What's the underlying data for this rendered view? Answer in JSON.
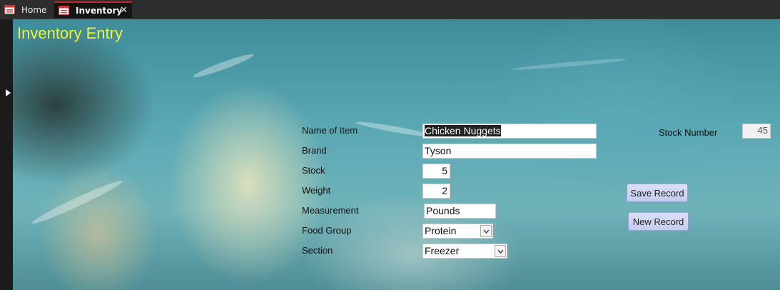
{
  "tabs": [
    {
      "label": "Home",
      "active": false
    },
    {
      "label": "Inventory",
      "active": true
    }
  ],
  "form": {
    "title": "Inventory Entry",
    "fields": {
      "name_of_item": {
        "label": "Name of Item",
        "value": "Chicken Nuggets"
      },
      "brand": {
        "label": "Brand",
        "value": "Tyson"
      },
      "stock": {
        "label": "Stock",
        "value": "5"
      },
      "weight": {
        "label": "Weight",
        "value": "2"
      },
      "measurement": {
        "label": "Measurement",
        "value": "Pounds"
      },
      "food_group": {
        "label": "Food Group",
        "value": "Protein"
      },
      "section": {
        "label": "Section",
        "value": "Freezer"
      },
      "stock_number": {
        "label": "Stock Number",
        "value": "45"
      }
    },
    "buttons": {
      "save": "Save Record",
      "new": "New Record"
    }
  },
  "colors": {
    "title": "#f2f23a",
    "active_tab_accent": "#b72b2b",
    "button_fill": "#c5cbef"
  }
}
